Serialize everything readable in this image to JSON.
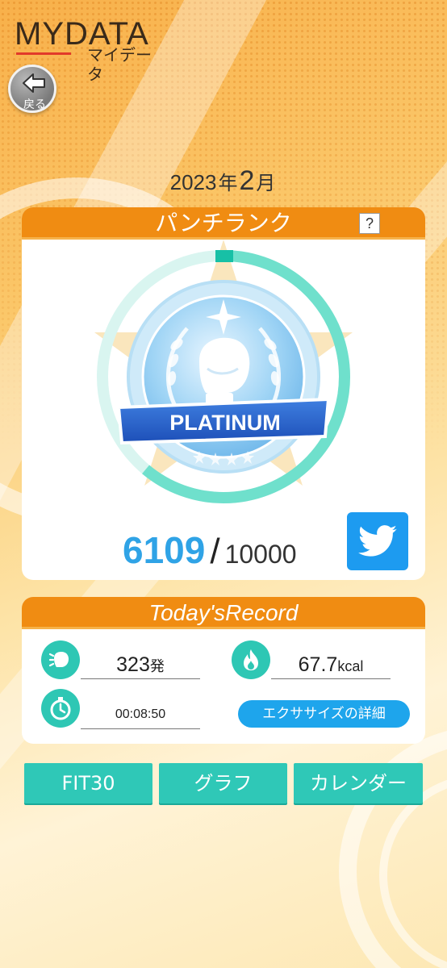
{
  "header": {
    "title": "MYDATA",
    "subtitle": "マイデータ",
    "back_label": "戻る"
  },
  "period": {
    "year": "2023",
    "year_unit": "年",
    "month": "2",
    "month_unit": "月"
  },
  "rank_card": {
    "title": "パンチランク",
    "help_label": "?",
    "badge_text": "PLATINUM",
    "progress_fraction": 0.6109,
    "score_current": "6109",
    "score_separator": "/",
    "score_max": "10000",
    "share_icon": "twitter-icon"
  },
  "record_card": {
    "title": "Today'sRecord",
    "punches": {
      "value": "323",
      "unit": "発",
      "icon": "punch-count-icon"
    },
    "calories": {
      "value": "67.7",
      "unit": "kcal",
      "icon": "flame-icon"
    },
    "time": {
      "value": "00:08:50",
      "icon": "stopwatch-icon"
    },
    "detail_button": "エクササイズの詳細"
  },
  "bottom_nav": {
    "fit30": "FIT30",
    "graph": "グラフ",
    "calendar": "カレンダー"
  },
  "colors": {
    "accent_orange": "#f08c12",
    "teal": "#2fc8b7",
    "blue": "#1ea5ec",
    "score_blue": "#2fa3e6"
  }
}
